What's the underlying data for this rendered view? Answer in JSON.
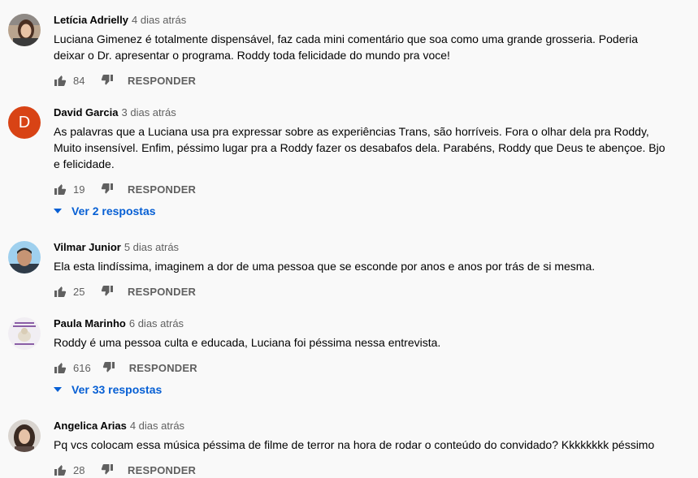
{
  "comments": [
    {
      "author": "Letícia Adrielly",
      "time": "4 dias atrás",
      "text": "Luciana Gimenez é totalmente dispensável, faz cada mini comentário que soa como uma grande grosseria. Poderia deixar o Dr. apresentar o programa. Roddy toda felicidade do mundo pra voce!",
      "likes": "84",
      "reply_label": "RESPONDER"
    },
    {
      "author": "David Garcia",
      "time": "3 dias atrás",
      "avatar_letter": "D",
      "text": "As palavras que a Luciana usa pra expressar sobre as experiências Trans, são horríveis. Fora o olhar dela pra Roddy, Muito insensível. Enfim, péssimo lugar pra a Roddy fazer os desabafos dela. Parabéns, Roddy que Deus te abençoe. Bjo e felicidade.",
      "likes": "19",
      "reply_label": "RESPONDER",
      "replies_label": "Ver 2 respostas"
    },
    {
      "author": "Vilmar Junior",
      "time": "5 dias atrás",
      "text": "Ela esta lindíssima, imaginem a dor de uma pessoa que se esconde por anos e anos por trás de si mesma.",
      "likes": "25",
      "reply_label": "RESPONDER"
    },
    {
      "author": "Paula Marinho",
      "time": "6 dias atrás",
      "text": "Roddy é uma pessoa culta e educada, Luciana foi péssima nessa entrevista.",
      "likes": "616",
      "reply_label": "RESPONDER",
      "replies_label": "Ver 33 respostas"
    },
    {
      "author": "Angelica Arias",
      "time": "4 dias atrás",
      "text": "Pq vcs colocam essa música péssima de filme de terror na hora de rodar o conteúdo do convidado? Kkkkkkkk péssimo",
      "likes": "28",
      "reply_label": "RESPONDER"
    }
  ],
  "colors": {
    "background": "#f9f9f9",
    "text": "#030303",
    "secondary": "#606060",
    "link": "#065fd4",
    "avatar_d": "#d84315"
  },
  "icons": [
    "thumb-up-icon",
    "thumb-down-icon",
    "chevron-down-icon"
  ]
}
